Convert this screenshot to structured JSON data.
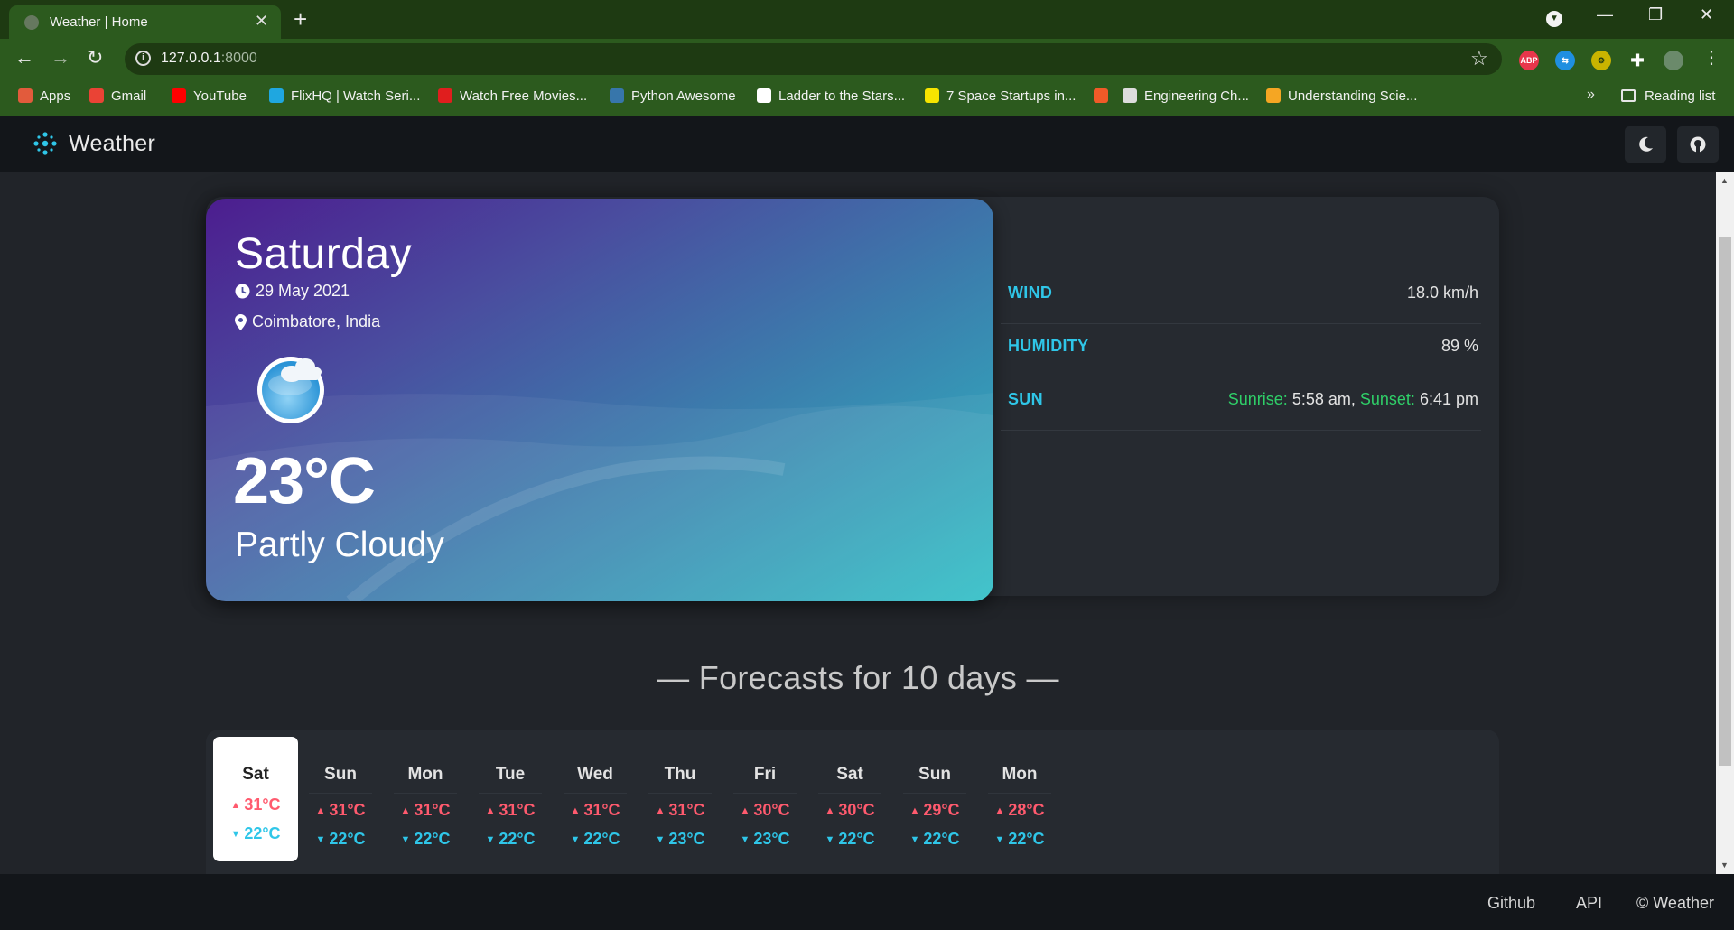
{
  "browser": {
    "tab_title": "Weather | Home",
    "url_host": "127.0.0.1",
    "url_port": ":8000",
    "bookmarks": [
      {
        "label": "Apps",
        "color": "#e25b3c"
      },
      {
        "label": "Gmail",
        "color": "#ea4335"
      },
      {
        "label": "YouTube",
        "color": "#ff0000"
      },
      {
        "label": "FlixHQ | Watch Seri...",
        "color": "#1fa7e0"
      },
      {
        "label": "Watch Free Movies...",
        "color": "#e01e1e"
      },
      {
        "label": "Python Awesome",
        "color": "#3776ab"
      },
      {
        "label": "Ladder to the Stars...",
        "color": "#ffffff"
      },
      {
        "label": "7 Space Startups in...",
        "color": "#f7e400"
      },
      {
        "label": "",
        "color": "#f05a28"
      },
      {
        "label": "Engineering Ch...",
        "color": "#dddddd"
      },
      {
        "label": "Understanding Scie...",
        "color": "#f5a623"
      }
    ],
    "reading_list": "Reading list",
    "more": "»"
  },
  "app": {
    "brand": "Weather",
    "colors": {
      "accent": "#2fc6e8",
      "high": "#ff5a6e",
      "sun": "#2fcf68"
    }
  },
  "current": {
    "day": "Saturday",
    "date": "29 May 2021",
    "location": "Coimbatore, India",
    "temperature": "23°C",
    "condition": "Partly Cloudy",
    "icon": "partly-cloudy-icon"
  },
  "stats": {
    "wind_label": "WIND",
    "wind_value": "18.0 km/h",
    "humidity_label": "HUMIDITY",
    "humidity_value": "89 %",
    "sun_label": "SUN",
    "sunrise_label": "Sunrise:",
    "sunrise_value": "5:58 am,",
    "sunset_label": "Sunset:",
    "sunset_value": "6:41 pm"
  },
  "forecast_title": "— Forecasts for 10 days —",
  "forecast": [
    {
      "day": "Sat",
      "high": "31°C",
      "low": "22°C",
      "active": true
    },
    {
      "day": "Sun",
      "high": "31°C",
      "low": "22°C",
      "active": false
    },
    {
      "day": "Mon",
      "high": "31°C",
      "low": "22°C",
      "active": false
    },
    {
      "day": "Tue",
      "high": "31°C",
      "low": "22°C",
      "active": false
    },
    {
      "day": "Wed",
      "high": "31°C",
      "low": "22°C",
      "active": false
    },
    {
      "day": "Thu",
      "high": "31°C",
      "low": "23°C",
      "active": false
    },
    {
      "day": "Fri",
      "high": "30°C",
      "low": "23°C",
      "active": false
    },
    {
      "day": "Sat",
      "high": "30°C",
      "low": "22°C",
      "active": false
    },
    {
      "day": "Sun",
      "high": "29°C",
      "low": "22°C",
      "active": false
    },
    {
      "day": "Mon",
      "high": "28°C",
      "low": "22°C",
      "active": false
    }
  ],
  "footer": {
    "github": "Github",
    "api": "API",
    "copyright": "© Weather"
  }
}
